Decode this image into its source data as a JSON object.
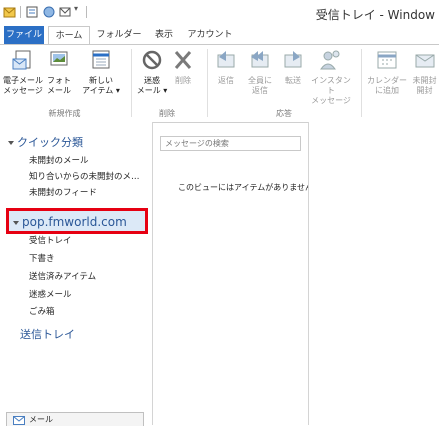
{
  "window": {
    "title": "受信トレイ - Window"
  },
  "tabs": [
    {
      "label": "ファイル"
    },
    {
      "label": "ホーム"
    },
    {
      "label": "フォルダー"
    },
    {
      "label": "表示"
    },
    {
      "label": "アカウント"
    }
  ],
  "ribbon": {
    "new_email": {
      "line1": "電子メール",
      "line2": "メッセージ"
    },
    "photo_mail": {
      "line1": "フォト",
      "line2": "メール"
    },
    "new_items": {
      "line1": "新しい",
      "line2": "アイテム ▾"
    },
    "group_new": "新規作成",
    "junk": {
      "line1": "迷惑",
      "line2": "メール ▾"
    },
    "delete": {
      "line1": "削除"
    },
    "group_delete": "削除",
    "reply": {
      "line1": "返信"
    },
    "reply_all": {
      "line1": "全員に",
      "line2": "返信"
    },
    "forward": {
      "line1": "転送"
    },
    "instant_message": {
      "line1": "インスタント",
      "line2": "メッセージ"
    },
    "group_respond": "応答",
    "add_to_calendar": {
      "line1": "カレンダー",
      "line2": "に追加"
    },
    "unread_read": {
      "line1": "未開封",
      "line2": "開封"
    }
  },
  "nav": {
    "quick_views": {
      "title": "クイック分類",
      "items": [
        "未開封のメール",
        "知り合いからの未開封のメ…",
        "未開封のフィード"
      ]
    },
    "account": {
      "title": "pop.fmworld.com",
      "folders": [
        "受信トレイ",
        "下書き",
        "送信済みアイテム",
        "迷惑メール",
        "ごみ箱"
      ]
    },
    "outbox": "送信トレイ",
    "mail_bar": "メール"
  },
  "list": {
    "search_placeholder": "メッセージの検索",
    "empty_text": "このビューにはアイテムがありません。"
  },
  "colors": {
    "file_tab": "#2b6fc5",
    "highlight_border": "#e60012",
    "section_text": "#2b5797"
  }
}
